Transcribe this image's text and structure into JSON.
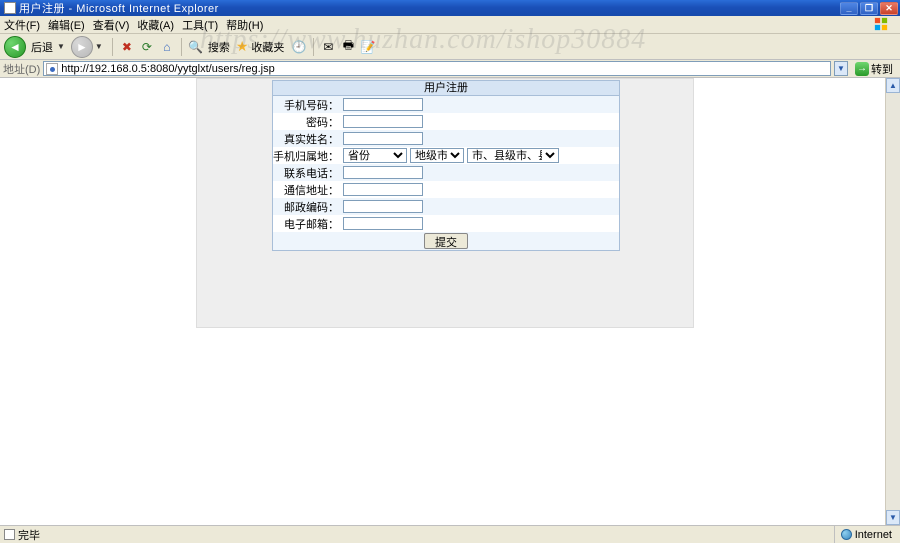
{
  "window": {
    "title": "用户注册 - Microsoft Internet Explorer"
  },
  "menu": {
    "file": "文件(F)",
    "edit": "编辑(E)",
    "view": "查看(V)",
    "favorites": "收藏(A)",
    "tools": "工具(T)",
    "help": "帮助(H)"
  },
  "toolbar": {
    "back": "后退",
    "search": "搜索",
    "favorites": "收藏夹"
  },
  "address": {
    "label": "地址(D)",
    "url": "http://192.168.0.5:8080/yytglxt/users/reg.jsp",
    "go": "转到"
  },
  "form": {
    "title": "用户注册",
    "phone_label": "手机号码：",
    "password_label": "密码：",
    "realname_label": "真实姓名：",
    "location_label": "手机归属地：",
    "contact_label": "联系电话：",
    "address_label": "通信地址：",
    "postal_label": "邮政编码：",
    "email_label": "电子邮箱：",
    "province_option": "省份",
    "city_option": "地级市",
    "county_option": "市、县级市、县",
    "submit": "提交"
  },
  "status": {
    "done": "完毕",
    "zone": "Internet"
  },
  "watermark": "https://www.huzhan.com/ishop30884"
}
